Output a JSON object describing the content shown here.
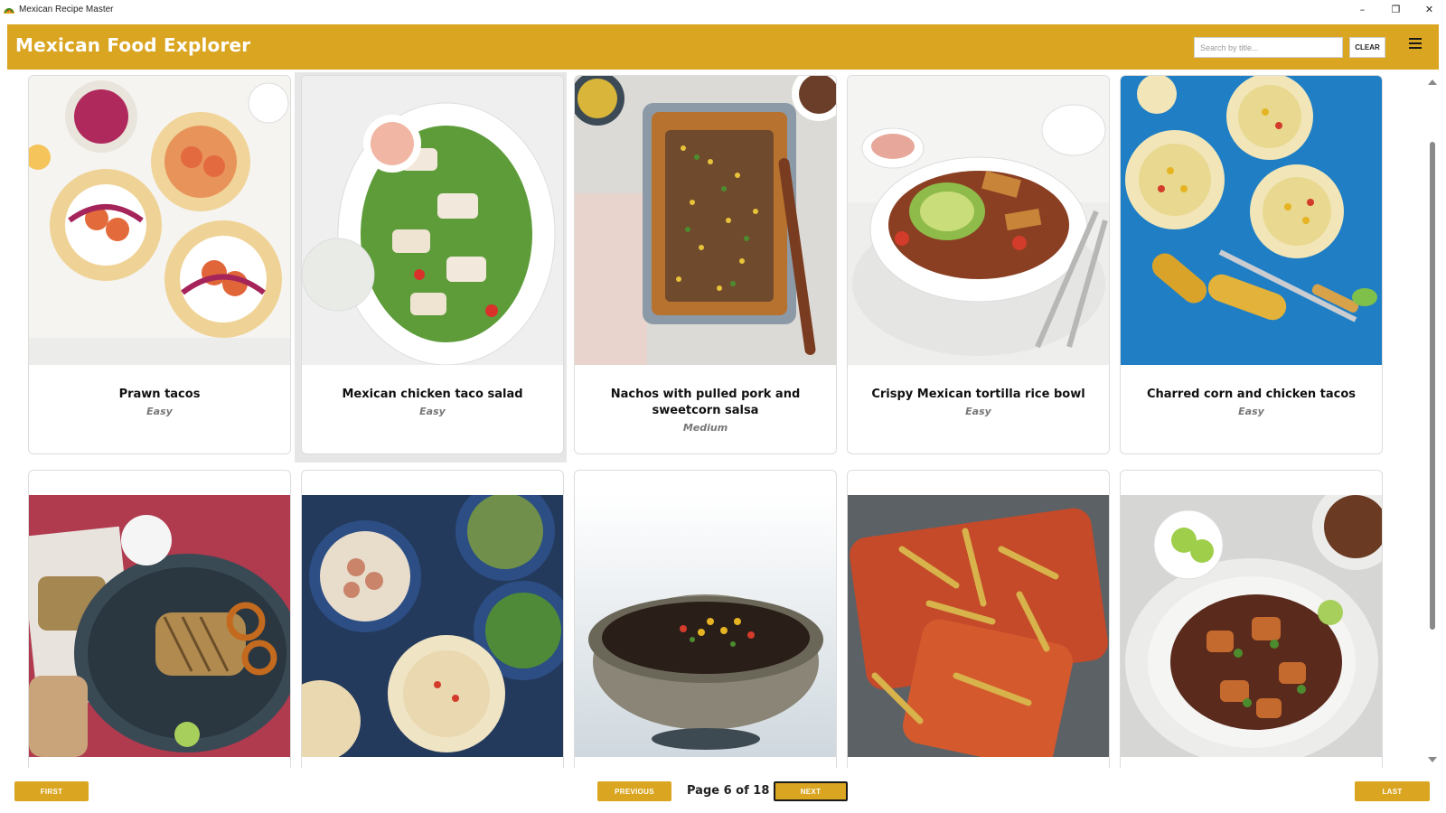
{
  "window": {
    "title": "Mexican Recipe Master",
    "controls": {
      "minimize": "–",
      "restore": "❐",
      "close": "✕"
    }
  },
  "header": {
    "title": "Mexican Food Explorer",
    "search_placeholder": "Search by title...",
    "search_value": "",
    "clear_label": "CLEAR",
    "menu_icon": "hamburger-menu-icon"
  },
  "colors": {
    "accent": "#DAA520",
    "text": "#111111",
    "muted": "#777777"
  },
  "recipes": [
    {
      "title": "Prawn tacos",
      "difficulty": "Easy"
    },
    {
      "title": "Mexican chicken taco salad",
      "difficulty": "Easy"
    },
    {
      "title": "Nachos with pulled pork and sweetcorn salsa",
      "difficulty": "Medium"
    },
    {
      "title": "Crispy Mexican tortilla rice bowl",
      "difficulty": "Easy"
    },
    {
      "title": "Charred corn and chicken tacos",
      "difficulty": "Easy"
    },
    {
      "title": "",
      "difficulty": ""
    },
    {
      "title": "",
      "difficulty": ""
    },
    {
      "title": "",
      "difficulty": ""
    },
    {
      "title": "",
      "difficulty": ""
    },
    {
      "title": "",
      "difficulty": ""
    }
  ],
  "pager": {
    "first": "FIRST",
    "previous": "PREVIOUS",
    "page_text": "Page 6 of 18",
    "next": "NEXT",
    "last": "LAST"
  }
}
